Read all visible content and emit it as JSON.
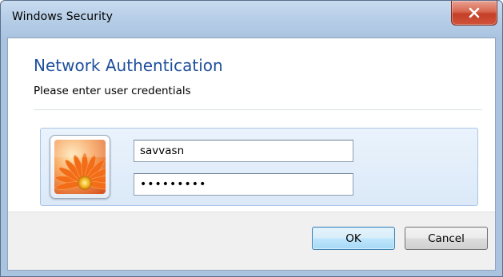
{
  "window": {
    "title": "Windows Security",
    "close_icon": "close-icon"
  },
  "dialog": {
    "heading": "Network Authentication",
    "subheading": "Please enter user credentials"
  },
  "credentials": {
    "avatar_icon": "user-tile-flower-icon",
    "username_value": "savvasn",
    "password_value": "•••••••••"
  },
  "buttons": {
    "ok_label": "OK",
    "cancel_label": "Cancel"
  },
  "colors": {
    "heading": "#1e4f9c",
    "close_button": "#c43f27",
    "panel_border": "#a9c5e6"
  }
}
